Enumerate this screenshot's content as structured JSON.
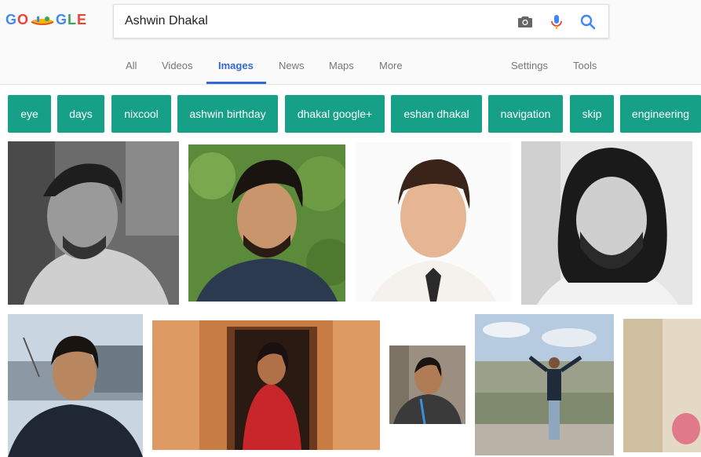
{
  "logo": {
    "letters": [
      "G",
      "O",
      "G",
      "L",
      "E"
    ],
    "colors": [
      "#4285f4",
      "#ea4335",
      "#4285f4",
      "#34a853",
      "#ea4335"
    ]
  },
  "search": {
    "query": "Ashwin Dhakal"
  },
  "tabs": [
    {
      "label": "All"
    },
    {
      "label": "Videos"
    },
    {
      "label": "Images"
    },
    {
      "label": "News"
    },
    {
      "label": "Maps"
    },
    {
      "label": "More"
    },
    {
      "label": "Settings"
    },
    {
      "label": "Tools"
    }
  ],
  "active_tab": "Images",
  "chips": [
    {
      "label": "eye"
    },
    {
      "label": "days"
    },
    {
      "label": "nixcool"
    },
    {
      "label": "ashwin birthday"
    },
    {
      "label": "dhakal google+"
    },
    {
      "label": "eshan dhakal"
    },
    {
      "label": "navigation"
    },
    {
      "label": "skip"
    },
    {
      "label": "engineering"
    }
  ],
  "colors": {
    "chip_bg": "#15a087",
    "accent": "#3367d6",
    "tab_text": "#777777",
    "mic_blue": "#4285f4",
    "mic_red": "#ea4335"
  },
  "icons": [
    "camera-icon",
    "microphone-icon",
    "search-icon"
  ],
  "images": [
    {
      "subject": "grayscale-portrait-man"
    },
    {
      "subject": "portrait-man-green-foliage"
    },
    {
      "subject": "blurred-portrait-man-tie"
    },
    {
      "subject": "grayscale-portrait-long-hair-beard"
    },
    {
      "subject": "man-harbor-background"
    },
    {
      "subject": "woman-red-dress-doorway"
    },
    {
      "subject": "man-with-lanyard"
    },
    {
      "subject": "man-arms-raised-city-view"
    },
    {
      "subject": "partial-image-right-edge"
    }
  ]
}
